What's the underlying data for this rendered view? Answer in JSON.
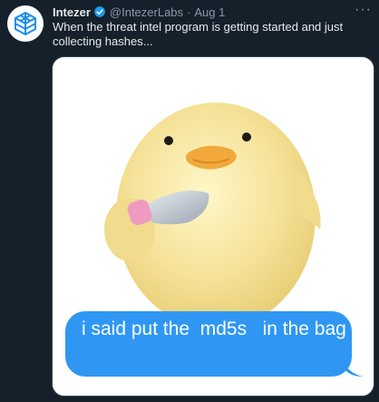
{
  "tweet": {
    "author_name": "Intezer",
    "handle": "@IntezerLabs",
    "separator": "·",
    "date": "Aug 1",
    "more_label": "···",
    "text": "When the threat intel program is getting started and just collecting hashes..."
  },
  "media": {
    "caption": "i said put the  md5s   in the bag",
    "bubble_color": "#2f97f3"
  },
  "colors": {
    "background": "#15202b",
    "verified": "#1d9bf0",
    "avatar_logo": "#1d8fe8"
  }
}
